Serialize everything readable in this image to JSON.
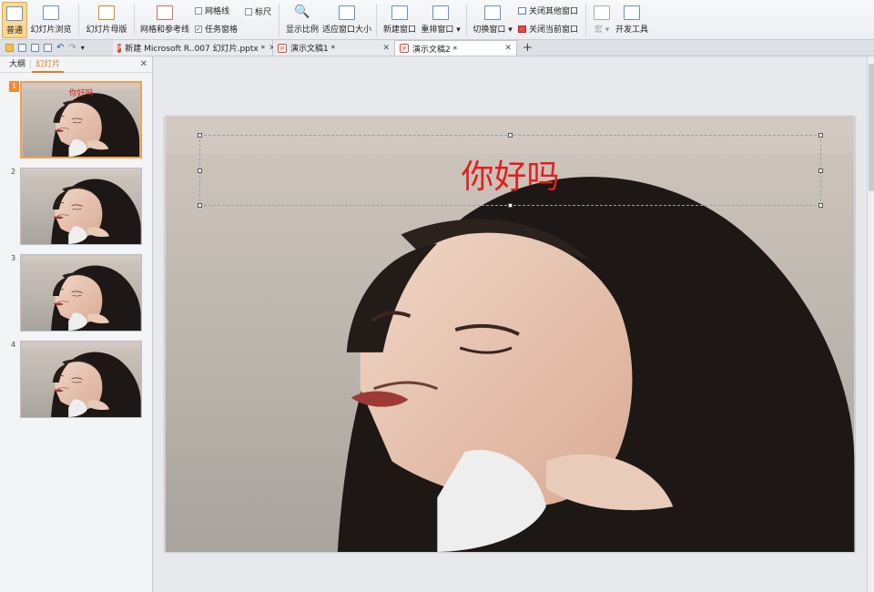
{
  "ribbon": {
    "btn_normal": "普通",
    "btn_slide_sorter": "幻灯片浏览",
    "btn_slide_master": "幻灯片母版",
    "btn_grid_guides": "网格和参考线",
    "chk_gridlines": "网格线",
    "chk_ruler": "标尺",
    "chk_task_pane": "任务窗格",
    "btn_zoom": "显示比例",
    "btn_fit_window": "适应窗口大小",
    "btn_new_window": "新建窗口",
    "btn_arrange": "重排窗口",
    "btn_switch_window": "切换窗口",
    "close_others": "关闭其他窗口",
    "close_current": "关闭当前窗口",
    "btn_macro": "宏",
    "btn_dev_tools": "开发工具"
  },
  "tabs": [
    {
      "label": "新建 Microsoft R..007 幻灯片.pptx *"
    },
    {
      "label": "演示文稿1 *"
    },
    {
      "label": "演示文稿2 *"
    }
  ],
  "panel": {
    "tab_outline": "大纲",
    "tab_slides": "幻灯片",
    "thumbs": [
      {
        "num": "1",
        "title": "你好吗"
      },
      {
        "num": "2"
      },
      {
        "num": "3"
      },
      {
        "num": "4"
      }
    ]
  },
  "slide": {
    "title": "你好吗",
    "colors": {
      "title": "#e0201c",
      "selection": "#f08a34"
    }
  }
}
